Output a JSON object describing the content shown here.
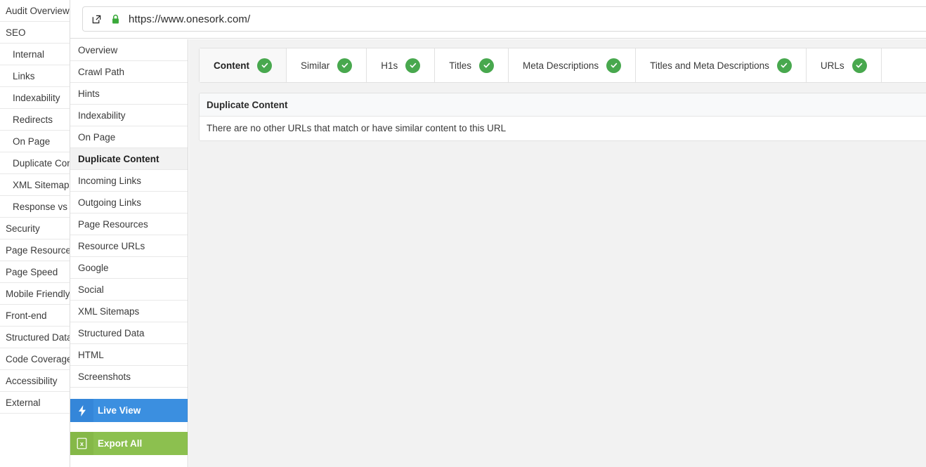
{
  "urlbar": {
    "url": "https://www.onesork.com/",
    "external_link_icon": "external-link-icon",
    "lock_icon": "padlock-icon",
    "lock_color": "#3aa93a"
  },
  "left_sidebar": {
    "items": [
      {
        "label": "Audit Overview",
        "level": 0
      },
      {
        "label": "SEO",
        "level": 0
      },
      {
        "label": "Internal",
        "level": 1
      },
      {
        "label": "Links",
        "level": 1
      },
      {
        "label": "Indexability",
        "level": 1
      },
      {
        "label": "Redirects",
        "level": 1
      },
      {
        "label": "On Page",
        "level": 1
      },
      {
        "label": "Duplicate Content",
        "level": 1
      },
      {
        "label": "XML Sitemaps",
        "level": 1
      },
      {
        "label": "Response vs Request",
        "level": 1
      },
      {
        "label": "Security",
        "level": 0
      },
      {
        "label": "Page Resources",
        "level": 0
      },
      {
        "label": "Page Speed",
        "level": 0
      },
      {
        "label": "Mobile Friendly",
        "level": 0
      },
      {
        "label": "Front-end",
        "level": 0
      },
      {
        "label": "Structured Data",
        "level": 0
      },
      {
        "label": "Code Coverage",
        "level": 0
      },
      {
        "label": "Accessibility",
        "level": 0
      },
      {
        "label": "External",
        "level": 0
      }
    ]
  },
  "mid_panel": {
    "items": [
      {
        "label": "Overview",
        "active": false
      },
      {
        "label": "Crawl Path",
        "active": false
      },
      {
        "label": "Hints",
        "active": false
      },
      {
        "label": "Indexability",
        "active": false
      },
      {
        "label": "On Page",
        "active": false
      },
      {
        "label": "Duplicate Content",
        "active": true
      },
      {
        "label": "Incoming Links",
        "active": false
      },
      {
        "label": "Outgoing Links",
        "active": false
      },
      {
        "label": "Page Resources",
        "active": false
      },
      {
        "label": "Resource URLs",
        "active": false
      },
      {
        "label": "Google",
        "active": false
      },
      {
        "label": "Social",
        "active": false
      },
      {
        "label": "XML Sitemaps",
        "active": false
      },
      {
        "label": "Structured Data",
        "active": false
      },
      {
        "label": "HTML",
        "active": false
      },
      {
        "label": "Screenshots",
        "active": false
      }
    ],
    "live_view": {
      "label": "Live View",
      "icon": "lightning-bolt-icon",
      "color": "#3b8fe0"
    },
    "export_all": {
      "label": "Export All",
      "icon": "spreadsheet-export-icon",
      "color": "#8cc04f"
    }
  },
  "main": {
    "tabs": [
      {
        "label": "Content",
        "active": true,
        "status": "ok"
      },
      {
        "label": "Similar",
        "active": false,
        "status": "ok"
      },
      {
        "label": "H1s",
        "active": false,
        "status": "ok"
      },
      {
        "label": "Titles",
        "active": false,
        "status": "ok"
      },
      {
        "label": "Meta Descriptions",
        "active": false,
        "status": "ok"
      },
      {
        "label": "Titles and Meta Descriptions",
        "active": false,
        "status": "ok"
      },
      {
        "label": "URLs",
        "active": false,
        "status": "ok"
      }
    ],
    "badge_color": "#48a84e",
    "badge_icon": "check-icon",
    "card": {
      "header": "Duplicate Content",
      "body": "There are no other URLs that match or have similar content to this URL"
    }
  }
}
